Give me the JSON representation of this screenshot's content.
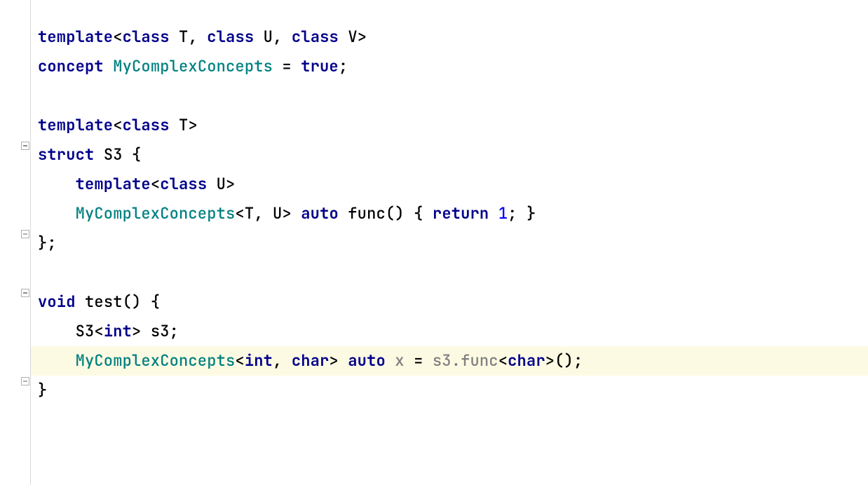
{
  "code": {
    "kw_template": "template",
    "kw_class": "class",
    "kw_concept": "concept",
    "kw_struct": "struct",
    "kw_auto": "auto",
    "kw_return": "return",
    "kw_void": "void",
    "kw_true": "true",
    "kw_int": "int",
    "kw_char": "char",
    "type_MyComplexConcepts": "MyComplexConcepts",
    "type_S3": "S3",
    "id_T": "T",
    "id_U": "U",
    "id_V": "V",
    "id_func": "func",
    "id_test": "test",
    "id_s3": "s3",
    "id_x": "x",
    "p_lt": "<",
    "p_gt": ">",
    "p_comma_sp": ", ",
    "p_eq": " = ",
    "p_semi": ";",
    "p_lbrace": "{",
    "p_rbrace": "}",
    "p_rbrace_semi": "};",
    "p_lparen": "(",
    "p_rparen": ")",
    "p_dot": ".",
    "p_sp": " ",
    "num_1": "1",
    "indent1": "    ",
    "indent0": ""
  },
  "highlight_line": 12,
  "fold_markers": [
    {
      "line": 5,
      "kind": "minus"
    },
    {
      "line": 8,
      "kind": "end"
    },
    {
      "line": 10,
      "kind": "minus"
    },
    {
      "line": 13,
      "kind": "end"
    }
  ]
}
